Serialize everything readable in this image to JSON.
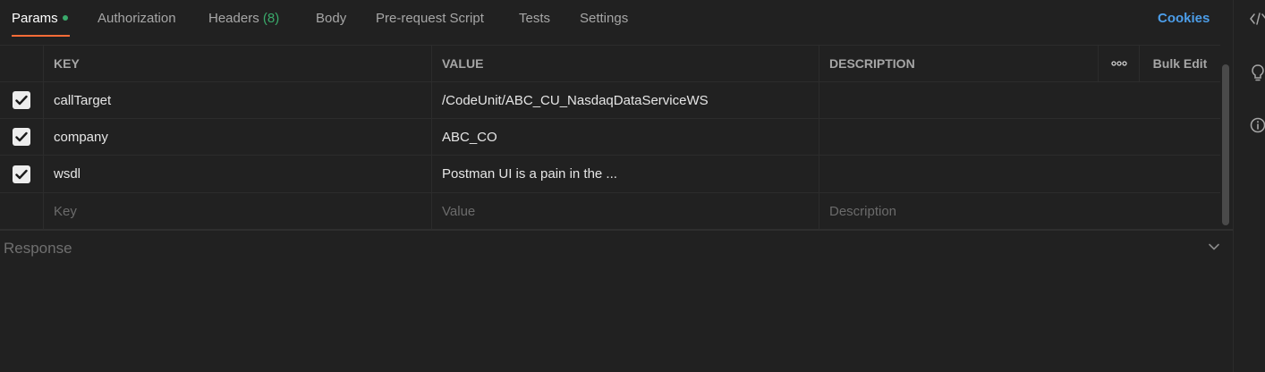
{
  "tabs": [
    {
      "label": "Params",
      "active": true,
      "dot": true
    },
    {
      "label": "Authorization"
    },
    {
      "label": "Headers",
      "count": "(8)"
    },
    {
      "label": "Body"
    },
    {
      "label": "Pre-request Script"
    },
    {
      "label": "Tests"
    },
    {
      "label": "Settings"
    }
  ],
  "cookies_label": "Cookies",
  "table": {
    "headers": {
      "key": "KEY",
      "value": "VALUE",
      "description": "DESCRIPTION",
      "more": "ooo",
      "bulk_edit": "Bulk Edit"
    },
    "rows": [
      {
        "checked": true,
        "key": "callTarget",
        "value": "/CodeUnit/ABC_CU_NasdaqDataServiceWS",
        "description": ""
      },
      {
        "checked": true,
        "key": "company",
        "value": "ABC_CO",
        "description": ""
      },
      {
        "checked": true,
        "key": "wsdl",
        "value": "Postman UI is a pain in the ...",
        "description": ""
      }
    ],
    "placeholders": {
      "key": "Key",
      "value": "Value",
      "description": "Description"
    }
  },
  "response": {
    "label": "Response"
  },
  "colors": {
    "accent": "#ff6c37",
    "link": "#4c9de8",
    "status_green": "#3aaa6b"
  },
  "icons": {
    "right_sidebar": [
      "code-icon",
      "lightbulb-icon",
      "info-icon"
    ],
    "collapse": "chevron-down-icon"
  }
}
